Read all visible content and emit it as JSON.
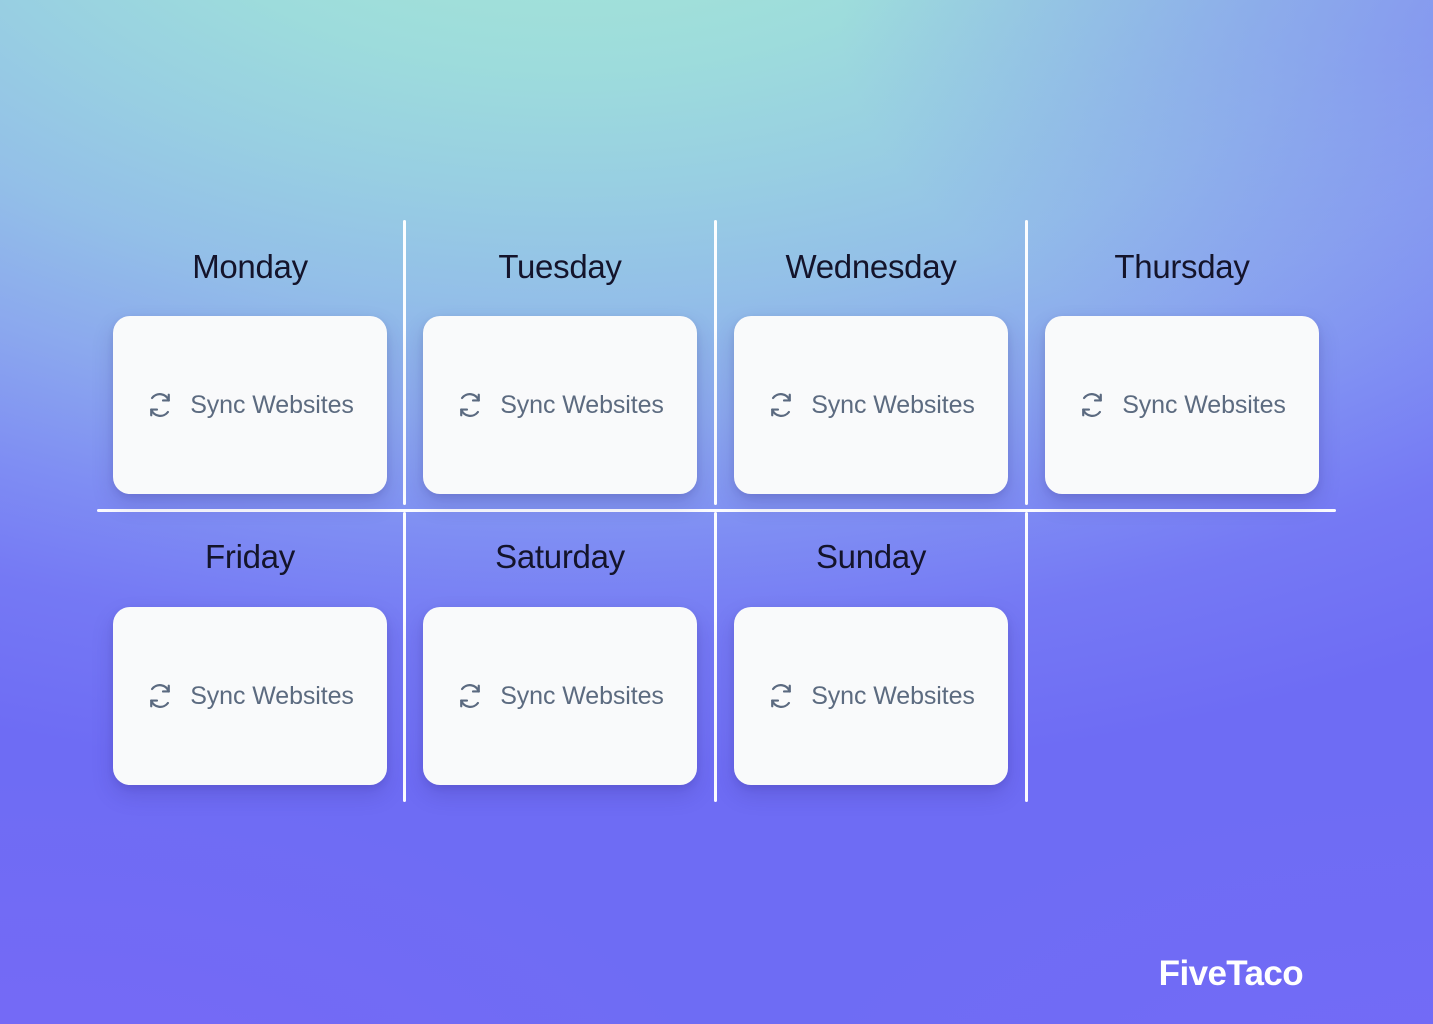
{
  "background": {
    "gradient_top": "#a9e6da",
    "gradient_mid": "#93bfe8",
    "gradient_bottom": "#6b5ff2"
  },
  "grid": {
    "line_color": "#ffffff",
    "rows": 2,
    "columns": 4
  },
  "calendar": {
    "days": [
      {
        "id": "monday",
        "title": "Monday",
        "row": 1,
        "column": 1,
        "task": {
          "label": "Sync Websites",
          "icon": "sync-icon"
        }
      },
      {
        "id": "tuesday",
        "title": "Tuesday",
        "row": 1,
        "column": 2,
        "task": {
          "label": "Sync Websites",
          "icon": "sync-icon"
        }
      },
      {
        "id": "wednesday",
        "title": "Wednesday",
        "row": 1,
        "column": 3,
        "task": {
          "label": "Sync Websites",
          "icon": "sync-icon"
        }
      },
      {
        "id": "thursday",
        "title": "Thursday",
        "row": 1,
        "column": 4,
        "task": {
          "label": "Sync Websites",
          "icon": "sync-icon"
        }
      },
      {
        "id": "friday",
        "title": "Friday",
        "row": 2,
        "column": 1,
        "task": {
          "label": "Sync Websites",
          "icon": "sync-icon"
        }
      },
      {
        "id": "saturday",
        "title": "Saturday",
        "row": 2,
        "column": 2,
        "task": {
          "label": "Sync Websites",
          "icon": "sync-icon"
        }
      },
      {
        "id": "sunday",
        "title": "Sunday",
        "row": 2,
        "column": 3,
        "task": {
          "label": "Sync Websites",
          "icon": "sync-icon"
        }
      }
    ]
  },
  "brand": {
    "name": "FiveTaco",
    "color": "#ffffff"
  }
}
